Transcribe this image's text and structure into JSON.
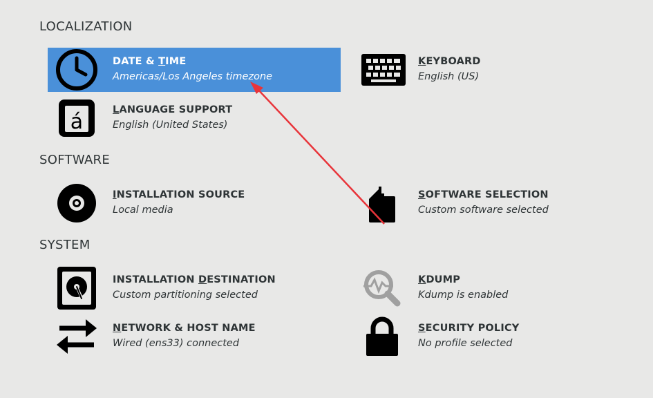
{
  "sections": {
    "localization": "LOCALIZATION",
    "software": "SOFTWARE",
    "system": "SYSTEM"
  },
  "spokes": {
    "date_time": {
      "title_pre": "DATE & ",
      "title_mnemonic": "T",
      "title_post": "IME",
      "status": "Americas/Los Angeles timezone",
      "icon": "clock-icon"
    },
    "keyboard": {
      "title_pre": "",
      "title_mnemonic": "K",
      "title_post": "EYBOARD",
      "status": "English (US)",
      "icon": "keyboard-icon"
    },
    "language": {
      "title_pre": "",
      "title_mnemonic": "L",
      "title_post": "ANGUAGE SUPPORT",
      "status": "English (United States)",
      "icon": "language-icon"
    },
    "install_source": {
      "title_pre": "",
      "title_mnemonic": "I",
      "title_post": "NSTALLATION SOURCE",
      "status": "Local media",
      "icon": "disc-icon"
    },
    "software_selection": {
      "title_pre": "",
      "title_mnemonic": "S",
      "title_post": "OFTWARE SELECTION",
      "status": "Custom software selected",
      "icon": "package-icon"
    },
    "install_destination": {
      "title_pre": "INSTALLATION ",
      "title_mnemonic": "D",
      "title_post": "ESTINATION",
      "status": "Custom partitioning selected",
      "icon": "harddisk-icon"
    },
    "kdump": {
      "title_pre": "",
      "title_mnemonic": "K",
      "title_post": "DUMP",
      "status": "Kdump is enabled",
      "icon": "magnifier-icon"
    },
    "network": {
      "title_pre": "",
      "title_mnemonic": "N",
      "title_post": "ETWORK & HOST NAME",
      "status": "Wired (ens33) connected",
      "icon": "network-arrows-icon"
    },
    "security": {
      "title_pre": "",
      "title_mnemonic": "S",
      "title_post": "ECURITY POLICY",
      "status": "No profile selected",
      "icon": "lock-icon"
    }
  },
  "colors": {
    "background": "#e8e8e7",
    "selected": "#4a90d9",
    "annotation_arrow": "#e8343a",
    "icon": "#000000",
    "icon_disabled": "#a0a0a0"
  }
}
